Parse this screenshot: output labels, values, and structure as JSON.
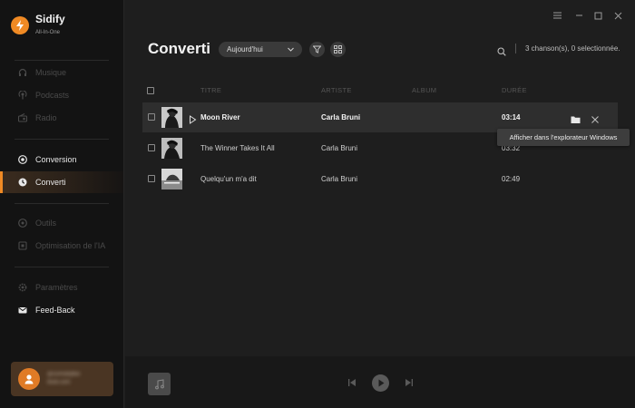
{
  "app": {
    "name": "Sidify",
    "subtitle": "All-In-One",
    "accent": "#f08a24"
  },
  "sidebar": {
    "items": [
      {
        "label": "Musique",
        "icon": "headphones-icon",
        "enabled": false
      },
      {
        "label": "Podcasts",
        "icon": "podcast-icon",
        "enabled": false
      },
      {
        "label": "Radio",
        "icon": "radio-icon",
        "enabled": false
      },
      {
        "label": "Conversion",
        "icon": "conversion-icon",
        "enabled": true
      },
      {
        "label": "Converti",
        "icon": "clock-icon",
        "enabled": true,
        "active": true
      },
      {
        "label": "Outils",
        "icon": "tools-icon",
        "enabled": false
      },
      {
        "label": "Optimisation de l'IA",
        "icon": "ai-icon",
        "enabled": false
      },
      {
        "label": "Paramètres",
        "icon": "gear-icon",
        "enabled": false
      },
      {
        "label": "Feed-Back",
        "icon": "mail-icon",
        "enabled": true
      }
    ],
    "account": {
      "email_line1": "@ssmsbrjfbw",
      "email_line2": "ilook.com"
    }
  },
  "window_controls": [
    "menu-icon",
    "minimize-icon",
    "maximize-icon",
    "close-icon"
  ],
  "header": {
    "title": "Converti",
    "filter_value": "Aujourd'hui",
    "summary": "3 chanson(s), 0 selectionnée."
  },
  "table": {
    "columns": [
      "TITRE",
      "ARTISTE",
      "ALBUM",
      "DURÉE"
    ],
    "rows": [
      {
        "title": "Moon River",
        "artist": "Carla Bruni",
        "album": "",
        "duration": "03:14"
      },
      {
        "title": "The Winner Takes It All",
        "artist": "Carla Bruni",
        "album": "",
        "duration": "03:32"
      },
      {
        "title": "Quelqu'un m'a dit",
        "artist": "Carla Bruni",
        "album": "",
        "duration": "02:49"
      }
    ]
  },
  "tooltip": "Afficher dans l'explorateur Windows"
}
